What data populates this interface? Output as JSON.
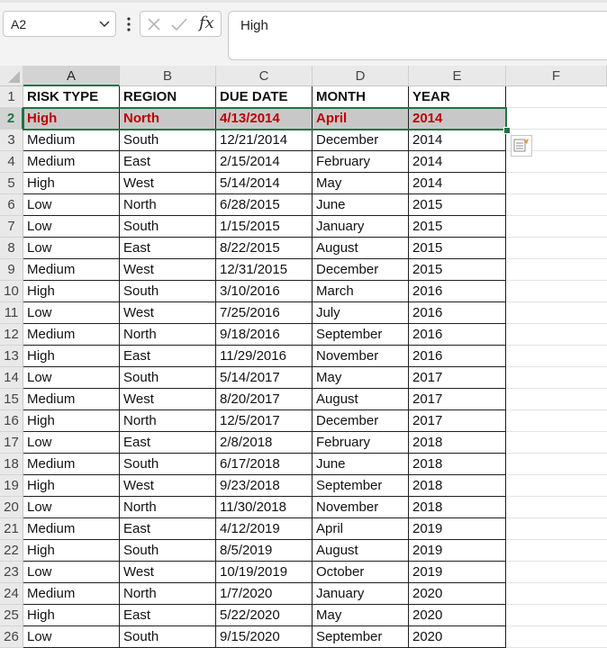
{
  "name_box": {
    "value": "A2"
  },
  "formula_bar": {
    "value": "High",
    "cancel_icon": "close-icon",
    "enter_icon": "checkmark-icon",
    "function_label": "fx"
  },
  "columns": [
    "A",
    "B",
    "C",
    "D",
    "E",
    "F"
  ],
  "selected_cell": {
    "column": "A",
    "row": 2
  },
  "headers": [
    "RISK TYPE",
    "REGION",
    "DUE DATE",
    "MONTH",
    "YEAR"
  ],
  "rows": [
    {
      "n": "1",
      "cells": [
        "RISK TYPE",
        "REGION",
        "DUE DATE",
        "MONTH",
        "YEAR"
      ]
    },
    {
      "n": "2",
      "cells": [
        "High",
        "North",
        "4/13/2014",
        "April",
        "2014"
      ]
    },
    {
      "n": "3",
      "cells": [
        "Medium",
        "South",
        "12/21/2014",
        "December",
        "2014"
      ]
    },
    {
      "n": "4",
      "cells": [
        "Medium",
        "East",
        "2/15/2014",
        "February",
        "2014"
      ]
    },
    {
      "n": "5",
      "cells": [
        "High",
        "West",
        "5/14/2014",
        "May",
        "2014"
      ]
    },
    {
      "n": "6",
      "cells": [
        "Low",
        "North",
        "6/28/2015",
        "June",
        "2015"
      ]
    },
    {
      "n": "7",
      "cells": [
        "Low",
        "South",
        "1/15/2015",
        "January",
        "2015"
      ]
    },
    {
      "n": "8",
      "cells": [
        "Low",
        "East",
        "8/22/2015",
        "August",
        "2015"
      ]
    },
    {
      "n": "9",
      "cells": [
        "Medium",
        "West",
        "12/31/2015",
        "December",
        "2015"
      ]
    },
    {
      "n": "10",
      "cells": [
        "High",
        "South",
        "3/10/2016",
        "March",
        "2016"
      ]
    },
    {
      "n": "11",
      "cells": [
        "Low",
        "West",
        "7/25/2016",
        "July",
        "2016"
      ]
    },
    {
      "n": "12",
      "cells": [
        "Medium",
        "North",
        "9/18/2016",
        "September",
        "2016"
      ]
    },
    {
      "n": "13",
      "cells": [
        "High",
        "East",
        "11/29/2016",
        "November",
        "2016"
      ]
    },
    {
      "n": "14",
      "cells": [
        "Low",
        "South",
        "5/14/2017",
        "May",
        "2017"
      ]
    },
    {
      "n": "15",
      "cells": [
        "Medium",
        "West",
        "8/20/2017",
        "August",
        "2017"
      ]
    },
    {
      "n": "16",
      "cells": [
        "High",
        "North",
        "12/5/2017",
        "December",
        "2017"
      ]
    },
    {
      "n": "17",
      "cells": [
        "Low",
        "East",
        "2/8/2018",
        "February",
        "2018"
      ]
    },
    {
      "n": "18",
      "cells": [
        "Medium",
        "South",
        "6/17/2018",
        "June",
        "2018"
      ]
    },
    {
      "n": "19",
      "cells": [
        "High",
        "West",
        "9/23/2018",
        "September",
        "2018"
      ]
    },
    {
      "n": "20",
      "cells": [
        "Low",
        "North",
        "11/30/2018",
        "November",
        "2018"
      ]
    },
    {
      "n": "21",
      "cells": [
        "Medium",
        "East",
        "4/12/2019",
        "April",
        "2019"
      ]
    },
    {
      "n": "22",
      "cells": [
        "High",
        "South",
        "8/5/2019",
        "August",
        "2019"
      ]
    },
    {
      "n": "23",
      "cells": [
        "Low",
        "West",
        "10/19/2019",
        "October",
        "2019"
      ]
    },
    {
      "n": "24",
      "cells": [
        "Medium",
        "North",
        "1/7/2020",
        "January",
        "2020"
      ]
    },
    {
      "n": "25",
      "cells": [
        "High",
        "East",
        "5/22/2020",
        "May",
        "2020"
      ]
    },
    {
      "n": "26",
      "cells": [
        "Low",
        "South",
        "9/15/2020",
        "September",
        "2020"
      ]
    }
  ],
  "highlight": {
    "row": "2",
    "text_color": "#c00000",
    "fill_color": "#c8c8c8"
  },
  "quick_action_icon": "quick-analysis-icon",
  "colors": {
    "accent": "#217346",
    "highlight_text": "#c00000"
  }
}
